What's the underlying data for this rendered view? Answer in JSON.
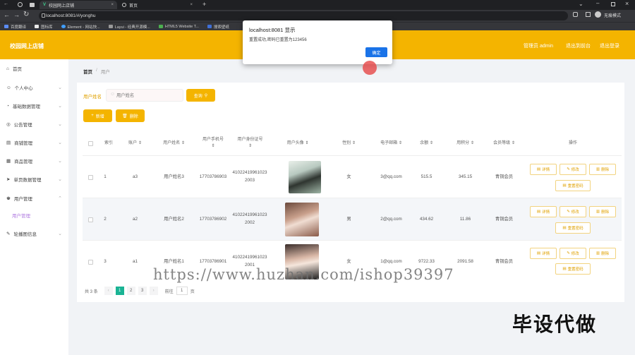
{
  "browser": {
    "tabs": [
      {
        "label": "校园网上店铺",
        "active": true
      },
      {
        "label": "首页",
        "active": false
      }
    ],
    "url": "localhost:8081/#/yonghu",
    "incognito_label": "无痕模式",
    "bookmarks": [
      "百度翻译",
      "图标库",
      "Element - 网站快...",
      "Layui - 经典开源模...",
      "HTML5 Website T...",
      "搜索壁纸"
    ]
  },
  "header": {
    "title": "校园网上店铺",
    "user_label": "管理员 admin",
    "back_label": "退出到前台",
    "logout_label": "退出登录"
  },
  "sidebar": {
    "items": [
      {
        "label": "首页",
        "icon": "home-icon",
        "chevron": false
      },
      {
        "label": "个人中心",
        "icon": "user-icon",
        "chevron": true
      },
      {
        "label": "基础数据管理",
        "icon": "bell-icon",
        "chevron": true
      },
      {
        "label": "公告管理",
        "icon": "compass-icon",
        "chevron": true
      },
      {
        "label": "商铺管理",
        "icon": "shop-icon",
        "chevron": true
      },
      {
        "label": "商品管理",
        "icon": "goods-icon",
        "chevron": true
      },
      {
        "label": "单页数据管理",
        "icon": "send-icon",
        "chevron": true
      },
      {
        "label": "用户管理",
        "icon": "user-group-icon",
        "chevron": true
      },
      {
        "label": "用户管理",
        "icon": "",
        "chevron": false,
        "sub": true
      },
      {
        "label": "轮播图信息",
        "icon": "image-icon",
        "chevron": true
      }
    ]
  },
  "breadcrumb": {
    "home": "首页",
    "separator": "/",
    "current": "用户"
  },
  "search": {
    "label": "用户姓名",
    "placeholder": "用户姓名",
    "button": "查询"
  },
  "actions": {
    "add": "新增",
    "delete": "删除"
  },
  "table": {
    "columns": [
      "索引",
      "账户",
      "用户姓名",
      "用户手机号",
      "用户身份证号",
      "用户头像",
      "性别",
      "电子邮箱",
      "余额",
      "用积分",
      "会员等级",
      "操作"
    ],
    "rows": [
      {
        "index": "1",
        "account": "a3",
        "name": "用户姓名3",
        "phone": "17703786903",
        "id_card": "410224199610232003",
        "gender": "女",
        "email": "3@qq.com",
        "balance": "515.5",
        "points": "345.15",
        "level": "青铜会员"
      },
      {
        "index": "2",
        "account": "a2",
        "name": "用户姓名2",
        "phone": "17703786902",
        "id_card": "410224199610232002",
        "gender": "男",
        "email": "2@qq.com",
        "balance": "434.62",
        "points": "11.86",
        "level": "青铜会员"
      },
      {
        "index": "3",
        "account": "a1",
        "name": "用户姓名1",
        "phone": "17703786901",
        "id_card": "410224199610232001",
        "gender": "女",
        "email": "1@qq.com",
        "balance": "9722.33",
        "points": "2091.58",
        "level": "青铜会员"
      }
    ],
    "row_actions": {
      "detail": "详情",
      "edit": "修改",
      "delete": "删除",
      "reset": "重置密码"
    }
  },
  "pagination": {
    "total": "共 3 条",
    "pages": [
      "1",
      "2",
      "3"
    ],
    "current": "1",
    "goto_label": "前往",
    "goto_value": "1",
    "page_unit": "页"
  },
  "dialog": {
    "title": "localhost:8081 显示",
    "message": "重置成功,密码已重置为123456",
    "confirm": "确定"
  },
  "overlay": {
    "watermark": "https://www.huzhan.com/ishop39397",
    "brand": "毕设代做"
  },
  "colors": {
    "accent": "#f4b400",
    "active_page": "#1ab394",
    "dialog_button": "#1a73e8"
  }
}
